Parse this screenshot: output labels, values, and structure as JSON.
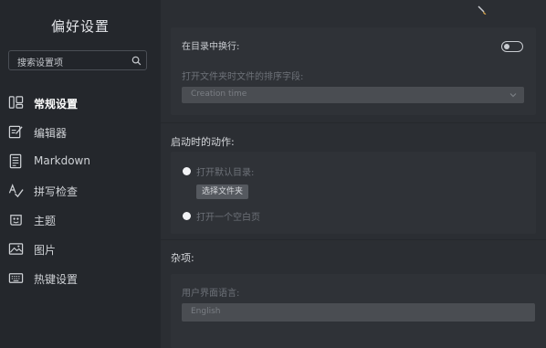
{
  "sidebar": {
    "title": "偏好设置",
    "search_placeholder": "搜索设置项",
    "items": [
      {
        "label": "常规设置",
        "icon": "general-settings-icon",
        "active": true
      },
      {
        "label": "编辑器",
        "icon": "editor-icon"
      },
      {
        "label": "Markdown",
        "icon": "markdown-icon"
      },
      {
        "label": "拼写检查",
        "icon": "spellcheck-icon"
      },
      {
        "label": "主题",
        "icon": "theme-icon"
      },
      {
        "label": "图片",
        "icon": "image-icon"
      },
      {
        "label": "热键设置",
        "icon": "keyboard-icon"
      }
    ]
  },
  "main": {
    "wrap_label": "在目录中换行:",
    "sort_label": "打开文件夹时文件的排序字段:",
    "sort_value": "Creation time",
    "startup_title": "启动时的动作:",
    "open_default_dir": "打开默认目录:",
    "choose_folder": "选择文件夹",
    "open_blank": "打开一个空白页",
    "misc_title": "杂项:",
    "ui_language_label": "用户界面语言:",
    "ui_language_value": "English"
  },
  "colors": {
    "sidebar_bg": "#24272c",
    "main_bg": "#2b2e33",
    "card_bg": "#2f3237"
  }
}
